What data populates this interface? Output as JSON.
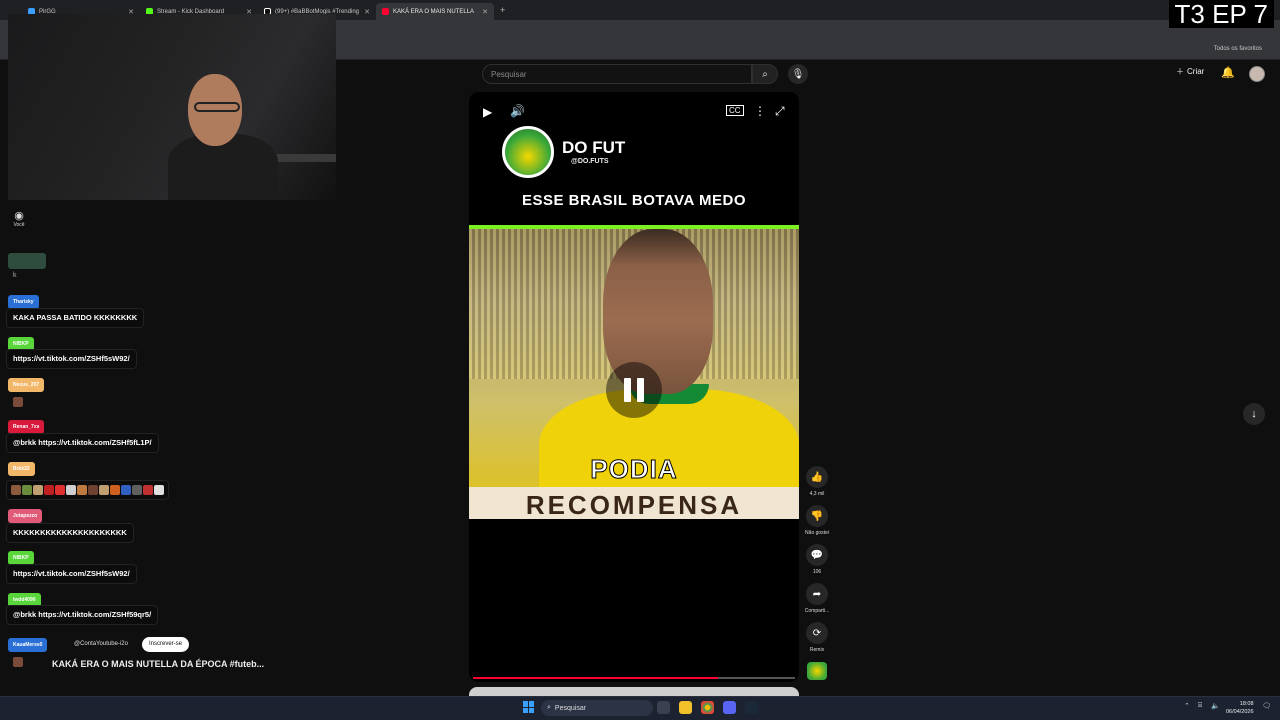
{
  "browser": {
    "tabs": [
      {
        "label": "PirGG",
        "active": false
      },
      {
        "label": "Stream - Kick Dashboard",
        "active": false
      },
      {
        "label": "(99+) #BaBBotMogis #Trending",
        "active": false
      },
      {
        "label": "KAKÁ ERA O MAIS NUTELLA",
        "active": true
      }
    ],
    "new_tab": "+",
    "bookmarks_all": "Todos os favoritos"
  },
  "episode_tag": "T3 EP 7",
  "youtube": {
    "search_placeholder": "Pesquisar",
    "create_label": "Criar"
  },
  "chat": {
    "you_label": "Você",
    "k_text": "k",
    "messages": [
      {
        "user": "Tharisky",
        "user_color": "#2a6fd6",
        "text": "KAKA PASSA BATIDO KKKKKKKK"
      },
      {
        "user": "NIBKP",
        "user_color": "#58d63a",
        "text": "https://vt.tiktok.com/ZSHf5sW92/"
      },
      {
        "user": "Nexus_207",
        "user_color": "#f3b76a",
        "text": ""
      },
      {
        "user": "Renan_7xs",
        "user_color": "#d81b3c",
        "text": "@brkk https://vt.tiktok.com/ZSHf5fL1P/"
      },
      {
        "user": "Brkk22",
        "user_color": "#f3b76a",
        "text": ""
      },
      {
        "user": "Jotapezzo",
        "user_color": "#e15b78",
        "text": "KKKKKKKKKKKKKKKKKKKKK"
      },
      {
        "user": "NIBKP",
        "user_color": "#58d63a",
        "text": "https://vt.tiktok.com/ZSHf5sW92/"
      },
      {
        "user": "lwdd4090",
        "user_color": "#58d63a",
        "text": "@brkk https://vt.tiktok.com/ZSHf59qr5/"
      },
      {
        "user": "KauaMerss0",
        "user_color": "#2a6fd6",
        "text": ""
      }
    ],
    "conta": "@ContaYoutube-i2o",
    "subscribe": "Inscrever-se",
    "video_title": "KAKÁ ERA O MAIS NUTELLA DA ÉPOCA  #futeb..."
  },
  "video": {
    "channel_name": "DO FUT",
    "channel_handle": "@DO.FUTS",
    "headline": "ESSE BRASIL BOTAVA MEDO",
    "caption_1": "PODIA",
    "caption_2": "RECOMPENSA",
    "progress": 0.76,
    "colors": {
      "accent_green": "#7cf020",
      "progress_red": "#ff0033",
      "jersey_yellow": "#f0d20b"
    }
  },
  "actions": {
    "likes": "4,3 mil",
    "dislike": "Não gostei",
    "comments": "106",
    "share": "Comparti...",
    "remix": "Remix"
  },
  "taskbar": {
    "search": "Pesquisar",
    "time": "18:08",
    "date": "06/04/2026"
  }
}
